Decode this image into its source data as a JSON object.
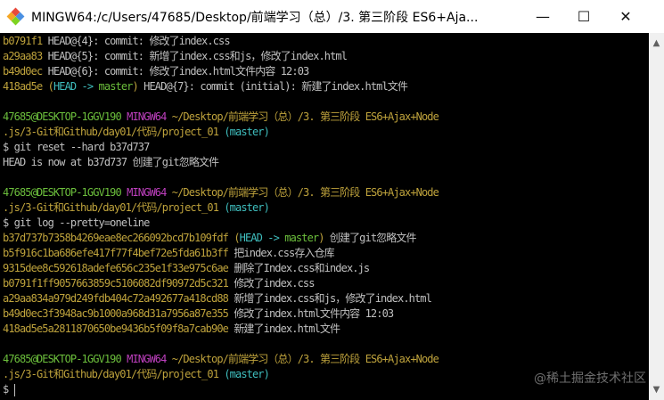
{
  "window": {
    "title": "MINGW64:/c/Users/47685/Desktop/前端学习（总）/3. 第三阶段 ES6+Aja...",
    "minimize": "—",
    "maximize": "☐",
    "close": "✕"
  },
  "prompt": {
    "user": "47685@DESKTOP-1GGV190",
    "system": "MINGW64",
    "path1": "~/Desktop/前端学习（总）/3. 第三阶段 ES6+Ajax+Node",
    "path2": ".js/3-Git和Github/day01/代码/project_01",
    "branch": "(master)",
    "symbol": "$"
  },
  "reflog": [
    {
      "hash": "b0791f1",
      "text": "HEAD@{4}: commit: 修改了index.css"
    },
    {
      "hash": "a29aa83",
      "text": "HEAD@{5}: commit: 新增了index.css和js，修改了index.html"
    },
    {
      "hash": "b49d0ec",
      "text": "HEAD@{6}: commit: 修改了index.html文件内容 12:03"
    },
    {
      "hash": "418ad5e",
      "head": "(HEAD -> master)",
      "text": "HEAD@{7}: commit (initial): 新建了index.html文件"
    }
  ],
  "cmd1": "git reset --hard b37d737",
  "cmd1_output": "HEAD is now at b37d737 创建了git忽略文件",
  "cmd2": "git log --pretty=oneline",
  "log": [
    {
      "hash": "b37d737b7358b4269eae8ec266092bcd7b109fdf",
      "head": "(HEAD -> master)",
      "msg": "创建了git忽略文件"
    },
    {
      "hash": "b5f916c1ba686efe417f77f4bef72e5fda61b3ff",
      "msg": "把index.css存入仓库"
    },
    {
      "hash": "9315dee8c592618adefe656c235e1f33e975c6ae",
      "msg": "删除了Index.css和index.js"
    },
    {
      "hash": "b0791f1ff9057663859c5106082df90972d5c321",
      "msg": "修改了index.css"
    },
    {
      "hash": "a29aa834a979d249fdb404c72a492677a418cd88",
      "msg": "新增了index.css和js，修改了index.html"
    },
    {
      "hash": "b49d0ec3f3948ac9b1000a968d31a7956a87e355",
      "msg": "修改了index.html文件内容 12:03"
    },
    {
      "hash": "418ad5e5a2811870650be9436b5f09f8a7cab90e",
      "msg": "新建了index.html文件"
    }
  ],
  "watermark": "@稀土掘金技术社区",
  "colors": {
    "hash": "#bfa33c",
    "user": "#6cbf3c",
    "system": "#bf40bf",
    "branch": "#3fbfbf",
    "text": "#c0c0c0"
  }
}
